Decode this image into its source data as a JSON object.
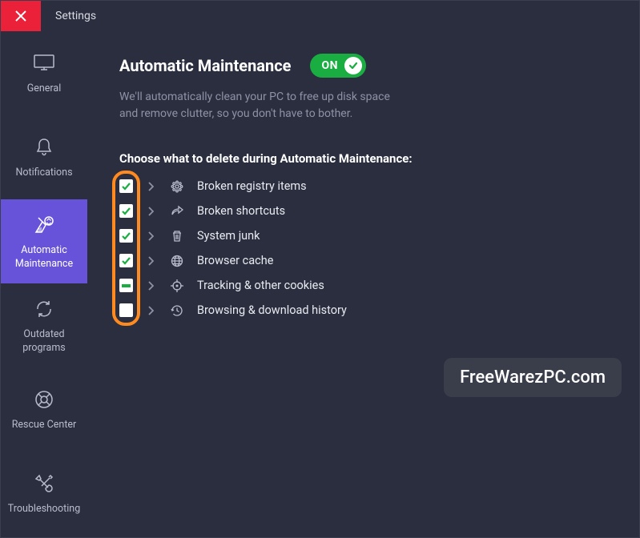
{
  "titlebar": {
    "title": "Settings"
  },
  "sidebar": {
    "items": [
      {
        "id": "general",
        "label": "General",
        "icon": "monitor-icon"
      },
      {
        "id": "notifications",
        "label": "Notifications",
        "icon": "bell-icon"
      },
      {
        "id": "automatic-maintenance",
        "label": "Automatic\nMaintenance",
        "icon": "broom-icon",
        "active": true
      },
      {
        "id": "outdated-programs",
        "label": "Outdated\nprograms",
        "icon": "refresh-icon"
      },
      {
        "id": "rescue-center",
        "label": "Rescue Center",
        "icon": "lifebuoy-icon"
      },
      {
        "id": "troubleshooting",
        "label": "Troubleshooting",
        "icon": "tools-icon"
      }
    ]
  },
  "main": {
    "title": "Automatic Maintenance",
    "toggle_label": "ON",
    "toggle_state": true,
    "description": "We'll automatically clean your PC to free up disk space and remove clutter, so you don't have to bother.",
    "section_label": "Choose what to delete during Automatic Maintenance:",
    "options": [
      {
        "label": "Broken registry items",
        "state": "checked",
        "icon": "gear-flower-icon"
      },
      {
        "label": "Broken shortcuts",
        "state": "checked",
        "icon": "share-arrow-icon"
      },
      {
        "label": "System junk",
        "state": "checked",
        "icon": "trash-icon"
      },
      {
        "label": "Browser cache",
        "state": "checked",
        "icon": "globe-icon"
      },
      {
        "label": "Tracking & other cookies",
        "state": "partial",
        "icon": "target-icon"
      },
      {
        "label": "Browsing & download history",
        "state": "unchecked",
        "icon": "history-icon"
      }
    ]
  },
  "watermark": "FreeWarezPC.com",
  "colors": {
    "accent": "#6753d9",
    "toggle_on": "#1aad42",
    "close": "#eb2139",
    "highlight": "#ff8a1f"
  }
}
